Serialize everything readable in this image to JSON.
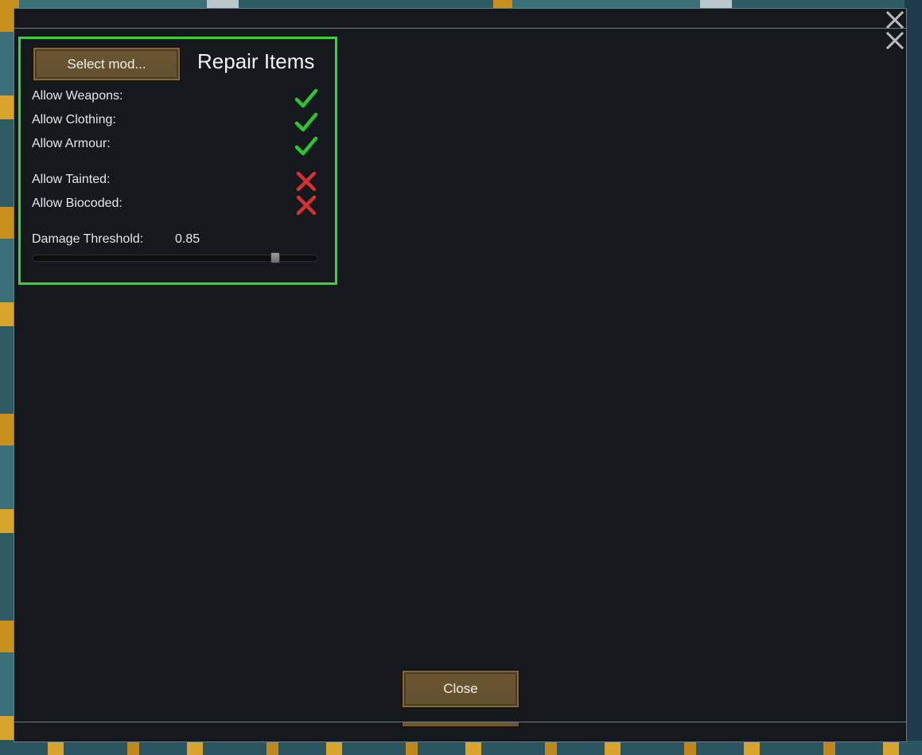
{
  "dialog": {
    "close_icon": "close-icon",
    "secondary_close_icon": "close-icon"
  },
  "panel": {
    "select_mod_label": "Select mod...",
    "title": "Repair Items",
    "border_color": "#38d33a",
    "settings": [
      {
        "label": "Allow Weapons:",
        "enabled": true,
        "icon": "check-icon"
      },
      {
        "label": "Allow Clothing:",
        "enabled": true,
        "icon": "check-icon"
      },
      {
        "label": "Allow Armour:",
        "enabled": true,
        "icon": "check-icon"
      },
      {
        "label": "Allow Tainted:",
        "enabled": false,
        "icon": "cross-icon"
      },
      {
        "label": "Allow Biocoded:",
        "enabled": false,
        "icon": "cross-icon"
      }
    ],
    "damage_threshold": {
      "label": "Damage Threshold:",
      "value_text": "0.85",
      "value": 0.85
    }
  },
  "footer": {
    "close_label": "Close"
  },
  "colors": {
    "check": "#2fc32f",
    "cross": "#d63030",
    "button": "#6c5633",
    "window_bg": "#15191e"
  }
}
